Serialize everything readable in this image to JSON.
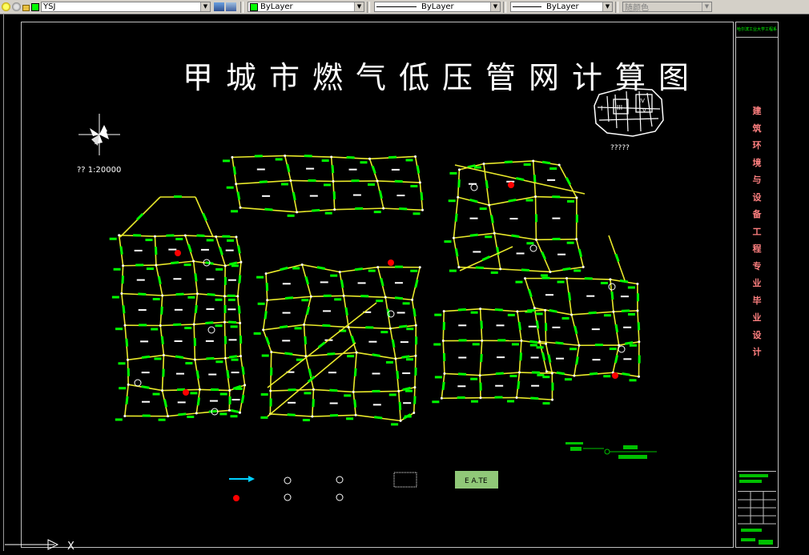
{
  "toolbar": {
    "layer_name": "YSJ",
    "color_label": "ByLayer",
    "linetype_label": "ByLayer",
    "lineweight_label": "ByLayer",
    "plotstyle_label": "随颜色"
  },
  "drawing": {
    "title": "甲城市燃气低压管网计算图",
    "scale_text": "??   1:20000",
    "keymap_label": "?????",
    "keymap_marks": [
      "I",
      "III",
      "IV",
      "V"
    ],
    "legend_box_text": "E A.TE",
    "sidebar_header": "哈尔滨工业大学工程系",
    "sidebar_vertical": "建筑环境与设备工程专业毕业设计"
  },
  "colors": {
    "pipe": "#e8e82a",
    "label": "#00ff00",
    "frame": "#bfbfbf",
    "highlight": "#ff0000",
    "legend_box": "#90c878"
  }
}
